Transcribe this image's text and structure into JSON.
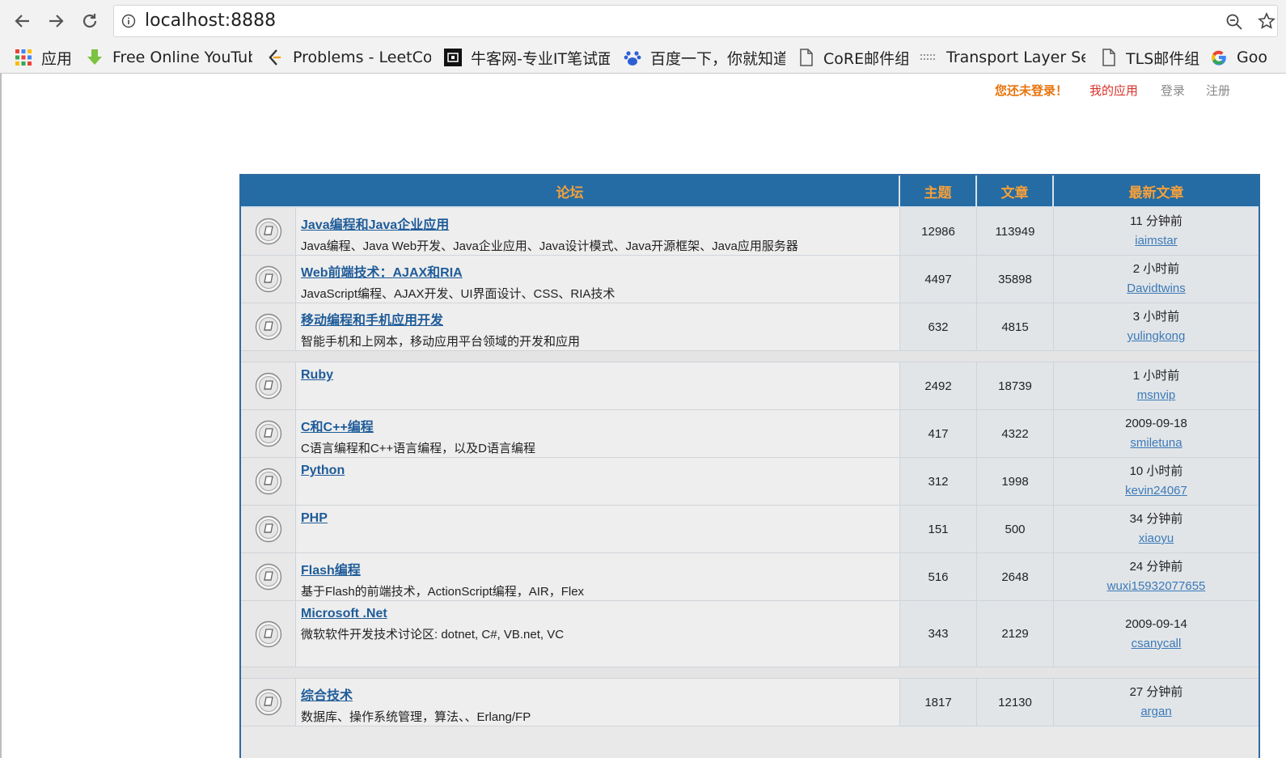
{
  "browser": {
    "url": "localhost:8888",
    "bookmarks": [
      {
        "label": "应用",
        "icon": "apps-grid-icon"
      },
      {
        "label": "Free Online YouTub",
        "icon": "download-arrow-icon"
      },
      {
        "label": "Problems - LeetCod",
        "icon": "leetcode-icon"
      },
      {
        "label": "牛客网-专业IT笔试面",
        "icon": "nowcoder-icon"
      },
      {
        "label": "百度一下，你就知道",
        "icon": "baidu-paw-icon"
      },
      {
        "label": "CoRE邮件组",
        "icon": "page-icon"
      },
      {
        "label": "Transport Layer Sec",
        "icon": "dotted-page-icon"
      },
      {
        "label": "TLS邮件组",
        "icon": "page-icon"
      },
      {
        "label": "Goo",
        "icon": "google-g-icon"
      }
    ]
  },
  "userbar": {
    "status": "您还未登录！",
    "my_apps": "我的应用",
    "login": "登录",
    "register": "注册"
  },
  "forum": {
    "headers": {
      "forum": "论坛",
      "topics": "主题",
      "posts": "文章",
      "latest": "最新文章"
    },
    "groups": [
      [
        {
          "title": "Java编程和Java企业应用",
          "desc": "Java编程、Java Web开发、Java企业应用、Java设计模式、Java开源框架、Java应用服务器",
          "topics": "12986",
          "posts": "113949",
          "time": "11 分钟前",
          "user": "iaimstar"
        },
        {
          "title": "Web前端技术：AJAX和RIA",
          "desc": "JavaScript编程、AJAX开发、UI界面设计、CSS、RIA技术",
          "topics": "4497",
          "posts": "35898",
          "time": "2 小时前",
          "user": "Davidtwins"
        },
        {
          "title": "移动编程和手机应用开发",
          "desc": "智能手机和上网本，移动应用平台领域的开发和应用",
          "topics": "632",
          "posts": "4815",
          "time": "3 小时前",
          "user": "yulingkong"
        }
      ],
      [
        {
          "title": "Ruby",
          "desc": "",
          "topics": "2492",
          "posts": "18739",
          "time": "1 小时前",
          "user": "msnvip"
        },
        {
          "title": "C和C++编程",
          "desc": "C语言编程和C++语言编程，以及D语言编程",
          "topics": "417",
          "posts": "4322",
          "time": "2009-09-18",
          "user": "smiletuna"
        },
        {
          "title": "Python",
          "desc": "",
          "topics": "312",
          "posts": "1998",
          "time": "10 小时前",
          "user": "kevin24067"
        },
        {
          "title": "PHP",
          "desc": "",
          "topics": "151",
          "posts": "500",
          "time": "34 分钟前",
          "user": "xiaoyu"
        },
        {
          "title": "Flash编程",
          "desc": "基于Flash的前端技术，ActionScript编程，AIR，Flex",
          "topics": "516",
          "posts": "2648",
          "time": "24 分钟前",
          "user": "wuxi15932077655"
        },
        {
          "title": "Microsoft .Net",
          "desc": "微软软件开发技术讨论区: dotnet, C#, VB.net, VC",
          "topics": "343",
          "posts": "2129",
          "time": "2009-09-14",
          "user": "csanycall"
        }
      ],
      [
        {
          "title": "综合技术",
          "desc": "数据库、操作系统管理，算法、、Erlang/FP",
          "topics": "1817",
          "posts": "12130",
          "time": "27 分钟前",
          "user": "argan"
        }
      ]
    ]
  }
}
